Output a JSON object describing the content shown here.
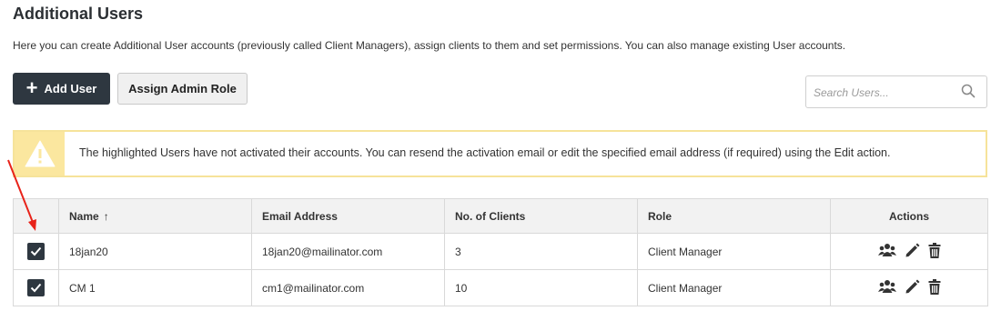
{
  "page": {
    "title": "Additional Users",
    "description": "Here you can create Additional User accounts (previously called Client Managers), assign clients to them and set permissions. You can also manage existing User accounts."
  },
  "toolbar": {
    "add_user_label": "Add User",
    "assign_admin_label": "Assign Admin Role",
    "search_placeholder": "Search Users..."
  },
  "alert": {
    "text": "The highlighted Users have not activated their accounts. You can resend the activation email or edit the specified email address (if required) using the Edit action."
  },
  "table": {
    "columns": {
      "name": "Name",
      "email": "Email Address",
      "clients": "No. of Clients",
      "role": "Role",
      "actions": "Actions"
    },
    "sort_icon": "↑",
    "rows": [
      {
        "checked": true,
        "name": "18jan20",
        "email": "18jan20@mailinator.com",
        "clients": "3",
        "role": "Client Manager"
      },
      {
        "checked": true,
        "name": "CM 1",
        "email": "cm1@mailinator.com",
        "clients": "10",
        "role": "Client Manager"
      }
    ]
  },
  "colors": {
    "dark_button": "#2e3740",
    "alert_border": "#f6e39a",
    "alert_icon_bg": "#fbe79f",
    "annotation_arrow": "#e8231a"
  }
}
